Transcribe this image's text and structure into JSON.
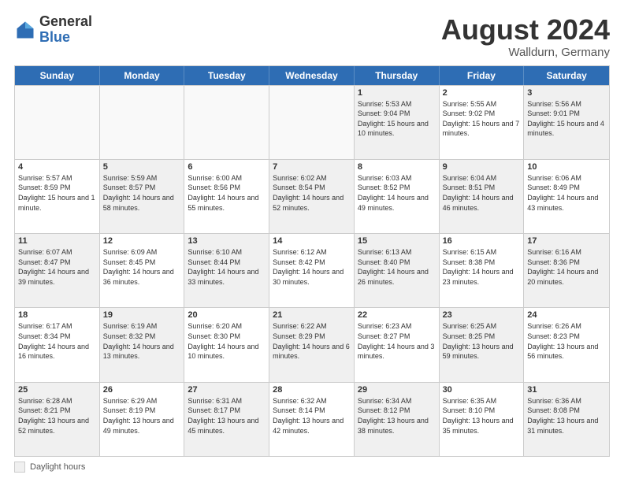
{
  "header": {
    "logo_general": "General",
    "logo_blue": "Blue",
    "month_title": "August 2024",
    "location": "Walldurn, Germany"
  },
  "days_of_week": [
    "Sunday",
    "Monday",
    "Tuesday",
    "Wednesday",
    "Thursday",
    "Friday",
    "Saturday"
  ],
  "weeks": [
    [
      {
        "day": "",
        "info": "",
        "shaded": false
      },
      {
        "day": "",
        "info": "",
        "shaded": false
      },
      {
        "day": "",
        "info": "",
        "shaded": false
      },
      {
        "day": "",
        "info": "",
        "shaded": false
      },
      {
        "day": "1",
        "info": "Sunrise: 5:53 AM\nSunset: 9:04 PM\nDaylight: 15 hours and 10 minutes.",
        "shaded": true
      },
      {
        "day": "2",
        "info": "Sunrise: 5:55 AM\nSunset: 9:02 PM\nDaylight: 15 hours and 7 minutes.",
        "shaded": false
      },
      {
        "day": "3",
        "info": "Sunrise: 5:56 AM\nSunset: 9:01 PM\nDaylight: 15 hours and 4 minutes.",
        "shaded": true
      }
    ],
    [
      {
        "day": "4",
        "info": "Sunrise: 5:57 AM\nSunset: 8:59 PM\nDaylight: 15 hours and 1 minute.",
        "shaded": false
      },
      {
        "day": "5",
        "info": "Sunrise: 5:59 AM\nSunset: 8:57 PM\nDaylight: 14 hours and 58 minutes.",
        "shaded": true
      },
      {
        "day": "6",
        "info": "Sunrise: 6:00 AM\nSunset: 8:56 PM\nDaylight: 14 hours and 55 minutes.",
        "shaded": false
      },
      {
        "day": "7",
        "info": "Sunrise: 6:02 AM\nSunset: 8:54 PM\nDaylight: 14 hours and 52 minutes.",
        "shaded": true
      },
      {
        "day": "8",
        "info": "Sunrise: 6:03 AM\nSunset: 8:52 PM\nDaylight: 14 hours and 49 minutes.",
        "shaded": false
      },
      {
        "day": "9",
        "info": "Sunrise: 6:04 AM\nSunset: 8:51 PM\nDaylight: 14 hours and 46 minutes.",
        "shaded": true
      },
      {
        "day": "10",
        "info": "Sunrise: 6:06 AM\nSunset: 8:49 PM\nDaylight: 14 hours and 43 minutes.",
        "shaded": false
      }
    ],
    [
      {
        "day": "11",
        "info": "Sunrise: 6:07 AM\nSunset: 8:47 PM\nDaylight: 14 hours and 39 minutes.",
        "shaded": true
      },
      {
        "day": "12",
        "info": "Sunrise: 6:09 AM\nSunset: 8:45 PM\nDaylight: 14 hours and 36 minutes.",
        "shaded": false
      },
      {
        "day": "13",
        "info": "Sunrise: 6:10 AM\nSunset: 8:44 PM\nDaylight: 14 hours and 33 minutes.",
        "shaded": true
      },
      {
        "day": "14",
        "info": "Sunrise: 6:12 AM\nSunset: 8:42 PM\nDaylight: 14 hours and 30 minutes.",
        "shaded": false
      },
      {
        "day": "15",
        "info": "Sunrise: 6:13 AM\nSunset: 8:40 PM\nDaylight: 14 hours and 26 minutes.",
        "shaded": true
      },
      {
        "day": "16",
        "info": "Sunrise: 6:15 AM\nSunset: 8:38 PM\nDaylight: 14 hours and 23 minutes.",
        "shaded": false
      },
      {
        "day": "17",
        "info": "Sunrise: 6:16 AM\nSunset: 8:36 PM\nDaylight: 14 hours and 20 minutes.",
        "shaded": true
      }
    ],
    [
      {
        "day": "18",
        "info": "Sunrise: 6:17 AM\nSunset: 8:34 PM\nDaylight: 14 hours and 16 minutes.",
        "shaded": false
      },
      {
        "day": "19",
        "info": "Sunrise: 6:19 AM\nSunset: 8:32 PM\nDaylight: 14 hours and 13 minutes.",
        "shaded": true
      },
      {
        "day": "20",
        "info": "Sunrise: 6:20 AM\nSunset: 8:30 PM\nDaylight: 14 hours and 10 minutes.",
        "shaded": false
      },
      {
        "day": "21",
        "info": "Sunrise: 6:22 AM\nSunset: 8:29 PM\nDaylight: 14 hours and 6 minutes.",
        "shaded": true
      },
      {
        "day": "22",
        "info": "Sunrise: 6:23 AM\nSunset: 8:27 PM\nDaylight: 14 hours and 3 minutes.",
        "shaded": false
      },
      {
        "day": "23",
        "info": "Sunrise: 6:25 AM\nSunset: 8:25 PM\nDaylight: 13 hours and 59 minutes.",
        "shaded": true
      },
      {
        "day": "24",
        "info": "Sunrise: 6:26 AM\nSunset: 8:23 PM\nDaylight: 13 hours and 56 minutes.",
        "shaded": false
      }
    ],
    [
      {
        "day": "25",
        "info": "Sunrise: 6:28 AM\nSunset: 8:21 PM\nDaylight: 13 hours and 52 minutes.",
        "shaded": true
      },
      {
        "day": "26",
        "info": "Sunrise: 6:29 AM\nSunset: 8:19 PM\nDaylight: 13 hours and 49 minutes.",
        "shaded": false
      },
      {
        "day": "27",
        "info": "Sunrise: 6:31 AM\nSunset: 8:17 PM\nDaylight: 13 hours and 45 minutes.",
        "shaded": true
      },
      {
        "day": "28",
        "info": "Sunrise: 6:32 AM\nSunset: 8:14 PM\nDaylight: 13 hours and 42 minutes.",
        "shaded": false
      },
      {
        "day": "29",
        "info": "Sunrise: 6:34 AM\nSunset: 8:12 PM\nDaylight: 13 hours and 38 minutes.",
        "shaded": true
      },
      {
        "day": "30",
        "info": "Sunrise: 6:35 AM\nSunset: 8:10 PM\nDaylight: 13 hours and 35 minutes.",
        "shaded": false
      },
      {
        "day": "31",
        "info": "Sunrise: 6:36 AM\nSunset: 8:08 PM\nDaylight: 13 hours and 31 minutes.",
        "shaded": true
      }
    ]
  ],
  "footer": {
    "legend_label": "Daylight hours"
  }
}
